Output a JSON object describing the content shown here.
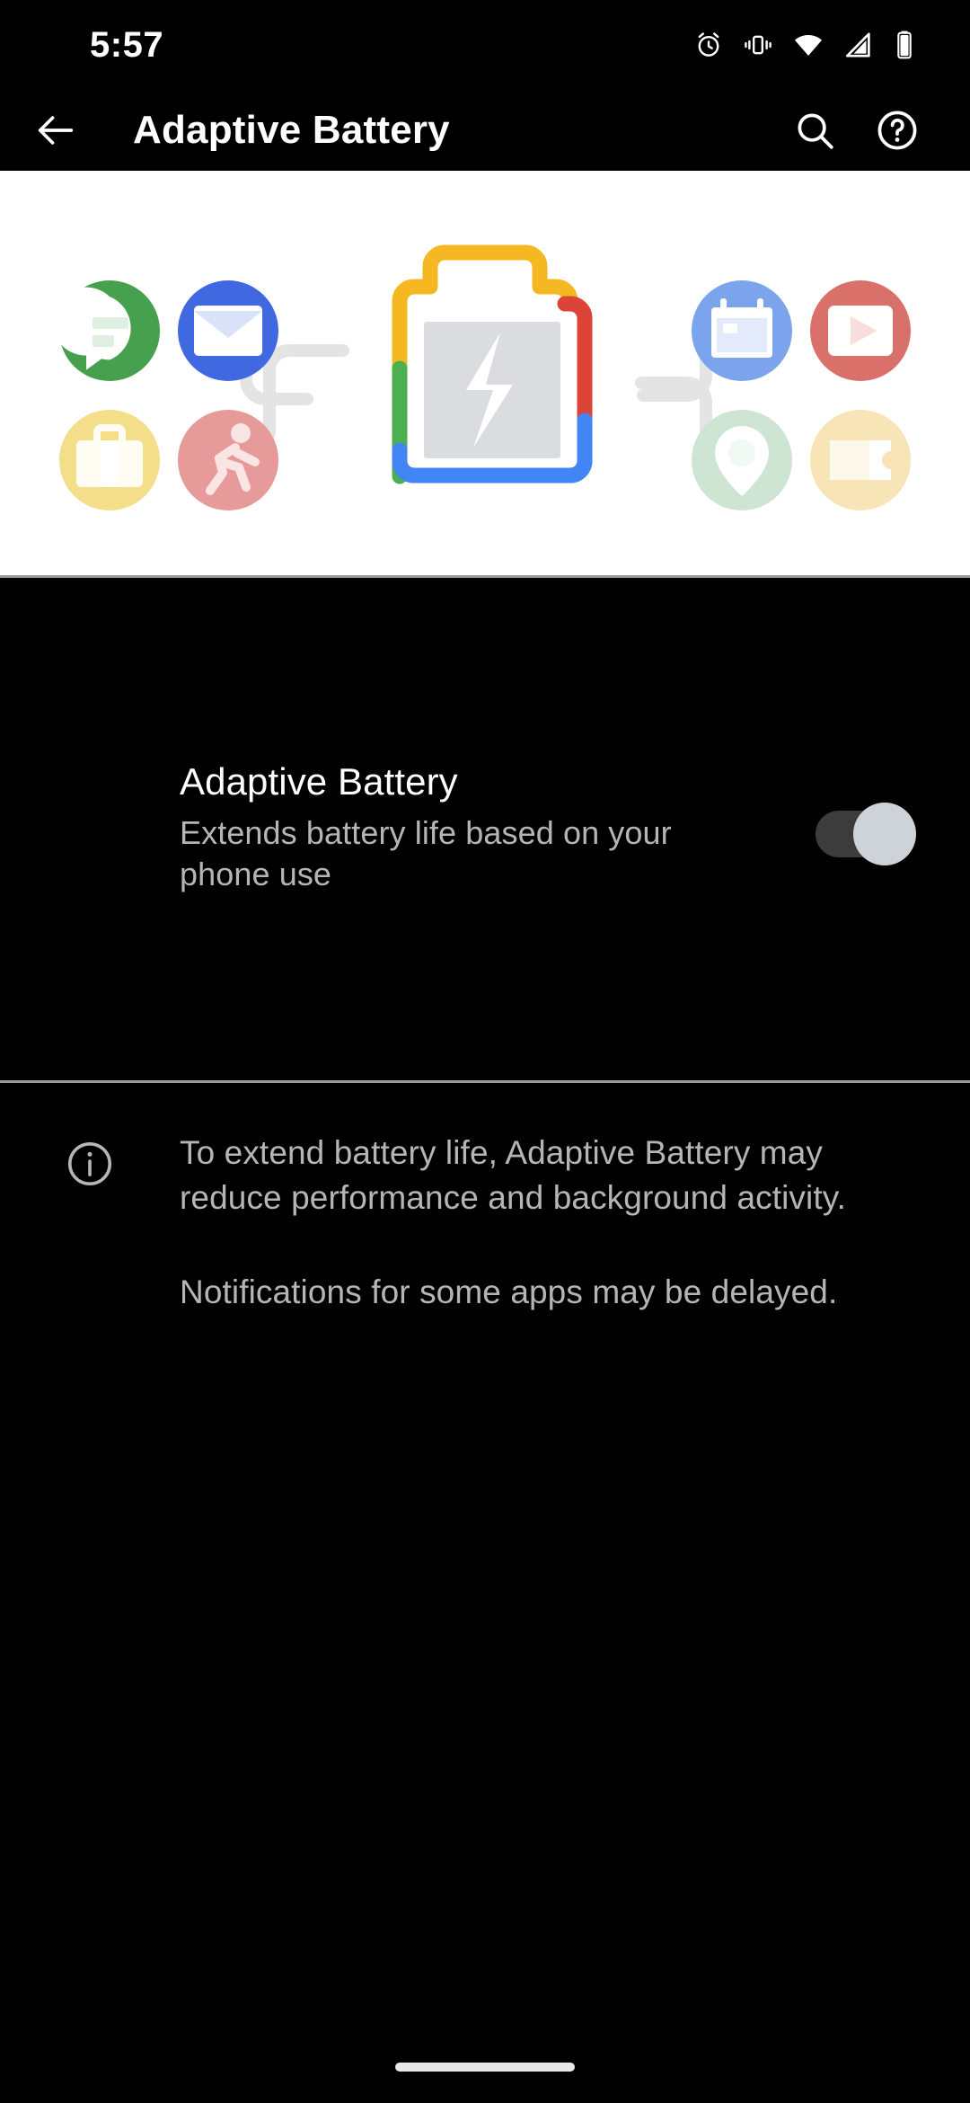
{
  "status_bar": {
    "time": "5:57",
    "icons": [
      "alarm-icon",
      "vibrate-icon",
      "wifi-icon",
      "signal-icon",
      "battery-icon"
    ]
  },
  "app_bar": {
    "back_label": "back-arrow-icon",
    "title": "Adaptive Battery",
    "search_label": "search-icon",
    "help_label": "help-icon"
  },
  "illustration": {
    "alt": "Apps connected to a charging battery",
    "background": "#ffffff",
    "battery": {
      "fill_color": "#dadce0",
      "bolt_color": "#ffffff",
      "outline_top_color": "#f5b823",
      "outline_left_color": "#f5b823",
      "outline_left_bottom_color": "#4caf50",
      "outline_right_color": "#db4437",
      "outline_bottom_color": "#4285f4"
    },
    "connector_color": "#e4e4e4",
    "apps_left": [
      {
        "name": "messages-app-icon",
        "circle": "#47a04e",
        "glyph": "#dff0e3"
      },
      {
        "name": "mail-app-icon",
        "circle": "#4069e1",
        "glyph": "#dae2fa"
      },
      {
        "name": "work-app-icon",
        "circle": "#f4de8a",
        "glyph": "#fffdf3"
      },
      {
        "name": "fitness-app-icon",
        "circle": "#e79a9a",
        "glyph": "#fbe4e4"
      }
    ],
    "apps_right": [
      {
        "name": "calendar-app-icon",
        "circle": "#7ba4ec",
        "glyph": "#e2eafb"
      },
      {
        "name": "video-app-icon",
        "circle": "#d9706a",
        "glyph": "#f8dedc"
      },
      {
        "name": "location-app-icon",
        "circle": "#cfe5d3",
        "glyph": "#f2f8f3"
      },
      {
        "name": "ticket-app-icon",
        "circle": "#f7e5b8",
        "glyph": "#fdf8ec"
      }
    ]
  },
  "setting": {
    "title": "Adaptive Battery",
    "subtitle": "Extends battery life based on your phone use",
    "switch_state": "on",
    "switch_track_color": "#3c3c3c",
    "switch_thumb_color": "#ced2d9"
  },
  "info": {
    "icon": "info-icon",
    "paragraphs": [
      "To extend battery life, Adaptive Battery may reduce performance and background activity.",
      "Notifications for some apps may be delayed."
    ]
  },
  "navigation": {
    "pill_label": "home-gesture-pill"
  }
}
